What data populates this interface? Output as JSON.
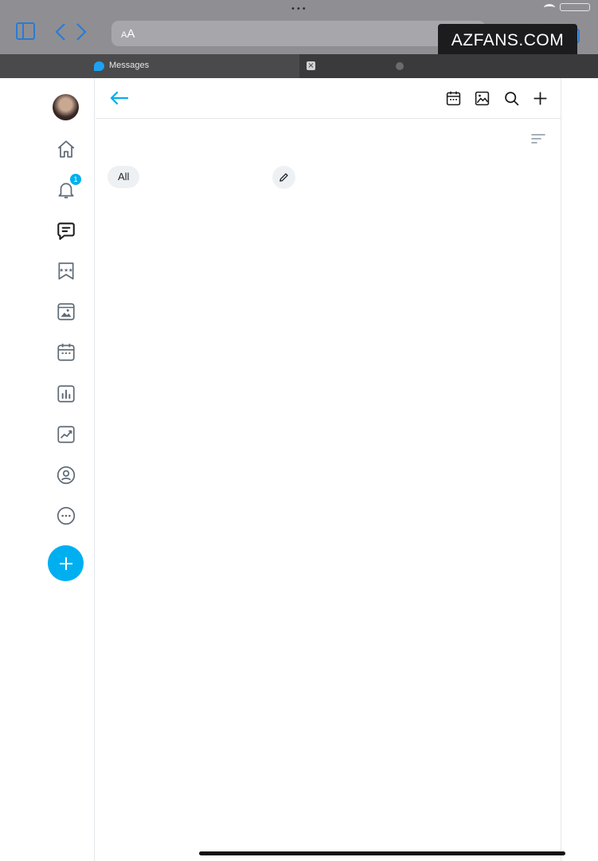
{
  "browser": {
    "status_indicator": "•••",
    "address_text_small": "A",
    "address_text_large": "A",
    "tab_title": "Messages",
    "tab_close_glyph": "×"
  },
  "watermark": "AZFANS.COM",
  "left_nav": {
    "items": [
      {
        "name": "home",
        "icon": "home-icon"
      },
      {
        "name": "notifications",
        "icon": "bell-icon",
        "badge": "1"
      },
      {
        "name": "messages",
        "icon": "message-icon"
      },
      {
        "name": "collections",
        "icon": "bookmark-stars-icon"
      },
      {
        "name": "vault",
        "icon": "image-icon"
      },
      {
        "name": "queue",
        "icon": "calendar-icon"
      },
      {
        "name": "statements",
        "icon": "bar-chart-icon"
      },
      {
        "name": "statistics",
        "icon": "trend-chart-icon"
      },
      {
        "name": "my-profile",
        "icon": "profile-icon"
      },
      {
        "name": "more",
        "icon": "more-icon"
      }
    ],
    "fab_icon": "plus-icon"
  },
  "main": {
    "header_title": "",
    "header_actions": [
      "calendar-icon",
      "image-icon",
      "search-icon",
      "plus-icon"
    ],
    "filter_chip": "All",
    "sort_icon": "sort-icon",
    "edit_icon": "pencil-icon"
  },
  "colors": {
    "accent": "#00aff0",
    "icon": "#5f6b76",
    "border": "#e4e7ea",
    "chip_bg": "#eef1f4"
  }
}
